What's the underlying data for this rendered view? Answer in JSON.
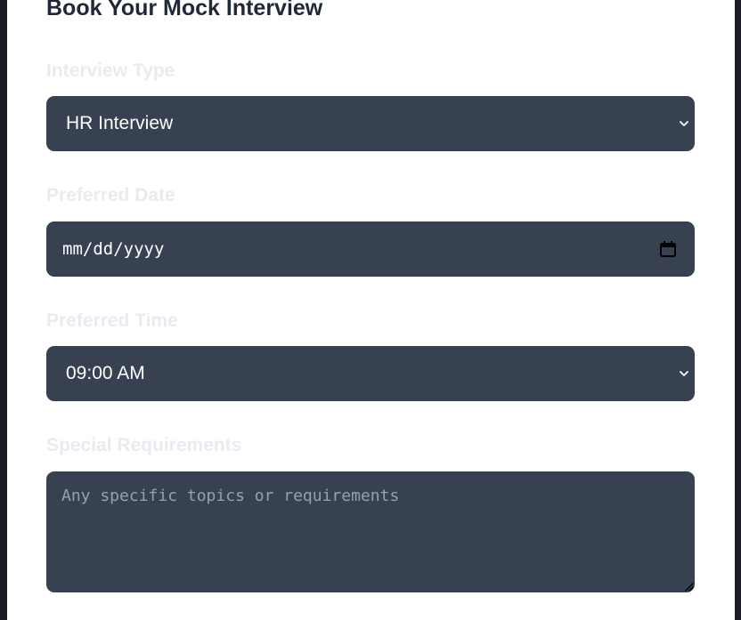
{
  "form": {
    "title": "Book Your Mock Interview",
    "interview_type": {
      "label": "Interview Type",
      "selected": "HR Interview",
      "icon": "chevron-down-icon"
    },
    "preferred_date": {
      "label": "Preferred Date",
      "placeholder": "mm/dd/yyyy",
      "icon": "calendar-icon"
    },
    "preferred_time": {
      "label": "Preferred Time",
      "selected": "09:00 AM",
      "icon": "chevron-down-icon"
    },
    "special_requirements": {
      "label": "Special Requirements",
      "placeholder": "Any specific topics or requirements"
    }
  },
  "colors": {
    "field_background": "#374151",
    "title_text": "#1f2937",
    "label_text": "#e8ebf0",
    "field_text": "#ffffff",
    "placeholder_text": "#9aa0a8"
  }
}
